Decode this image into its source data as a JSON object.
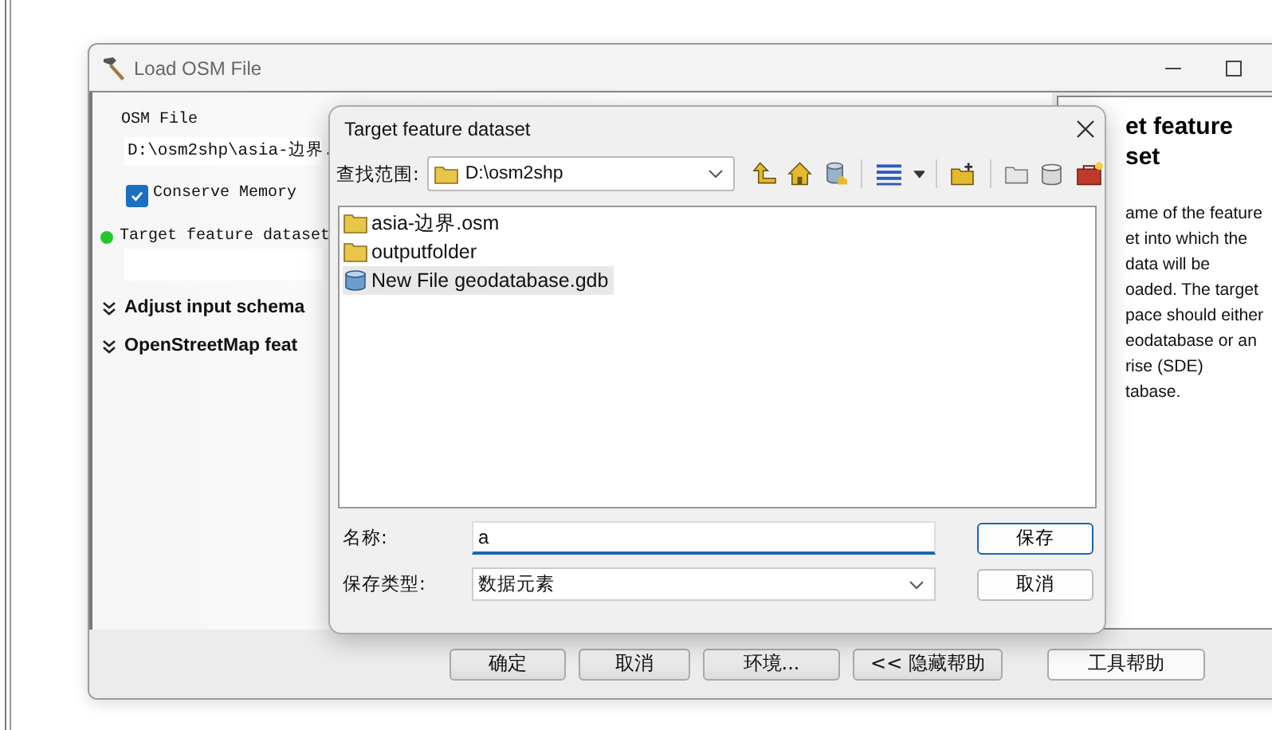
{
  "window": {
    "title": "Load OSM File"
  },
  "form": {
    "osm_file": {
      "label": "OSM File",
      "value": "D:\\osm2shp\\asia-边界."
    },
    "conserve_memory": {
      "label": "Conserve Memory",
      "checked": true
    },
    "target_dataset": {
      "label": "Target feature dataset",
      "required": true
    },
    "sections": [
      {
        "label": "Adjust input schema",
        "expanded": false
      },
      {
        "label": "OpenStreetMap feat",
        "expanded": false
      }
    ]
  },
  "help": {
    "title_lines": [
      "et feature",
      "set"
    ],
    "body_lines": [
      "ame of the feature",
      "et into which the",
      "data will be",
      "oaded. The target",
      "pace should either",
      "eodatabase or an",
      "rise (SDE)",
      "tabase."
    ]
  },
  "buttons": [
    "确定",
    "取消",
    "环境...",
    "<< 隐藏帮助",
    "工具帮助"
  ],
  "dialog": {
    "title": "Target feature dataset",
    "look_in": {
      "label": "查找范围:",
      "value": "D:\\osm2shp"
    },
    "files": [
      {
        "name": "asia-边界.osm",
        "kind": "folder",
        "selected": false
      },
      {
        "name": "outputfolder",
        "kind": "folder",
        "selected": false
      },
      {
        "name": "New File geodatabase.gdb",
        "kind": "geodatabase",
        "selected": true
      }
    ],
    "name": {
      "label": "名称:",
      "value": "a"
    },
    "type": {
      "label": "保存类型:",
      "value": "数据元素"
    },
    "buttons": [
      "保存",
      "取消"
    ]
  }
}
